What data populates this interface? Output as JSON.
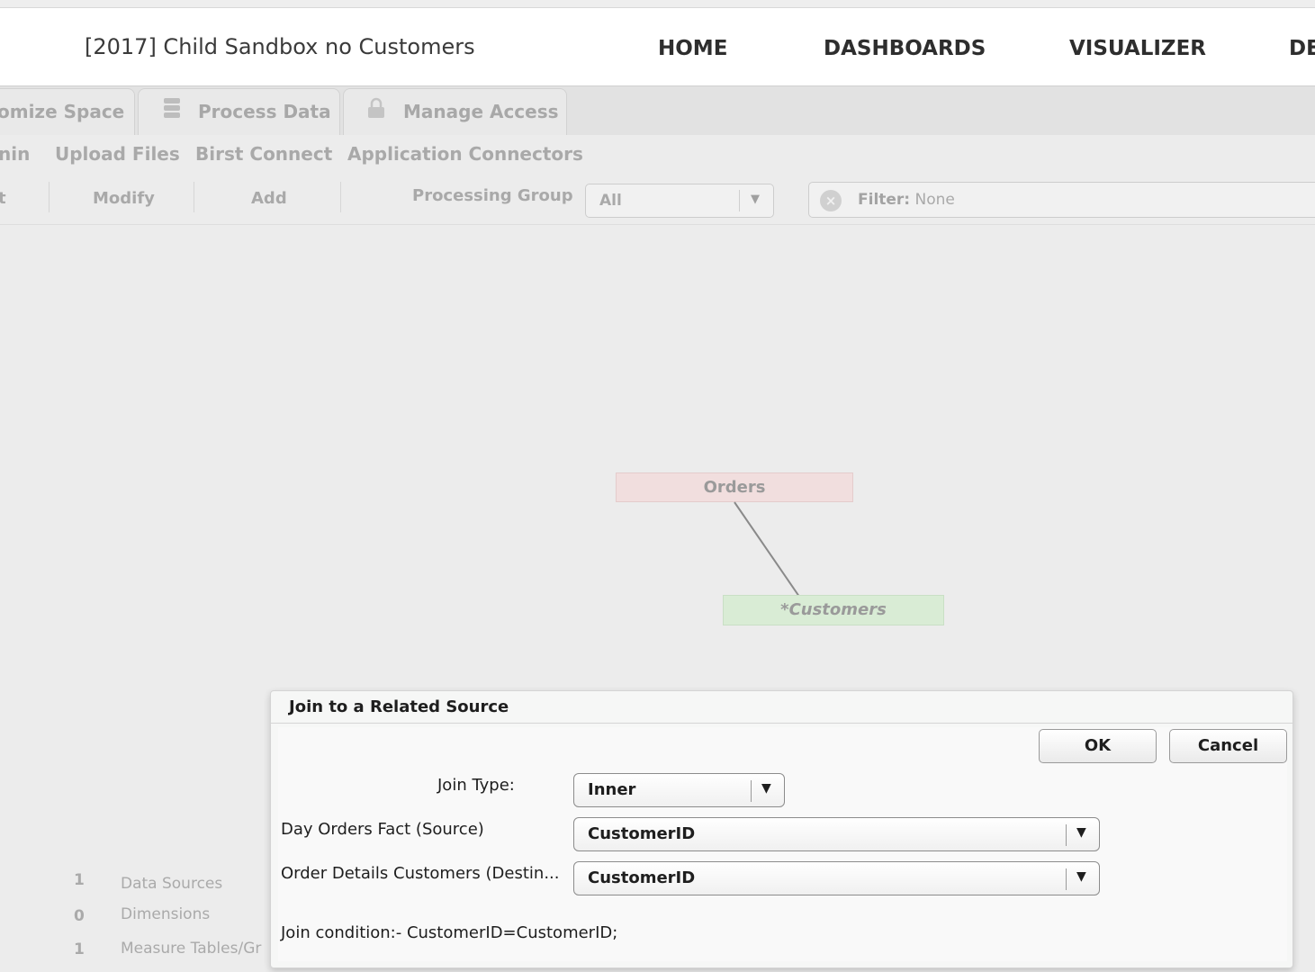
{
  "header": {
    "space_title": "[2017] Child Sandbox no Customers",
    "nav": [
      "HOME",
      "DASHBOARDS",
      "VISUALIZER",
      "DE"
    ]
  },
  "tabs": [
    {
      "label": "omize Space",
      "icon": ""
    },
    {
      "label": "Process Data",
      "icon": "database-icon"
    },
    {
      "label": "Manage Access",
      "icon": "lock-icon"
    }
  ],
  "subnav": [
    "nin",
    "Upload Files",
    "Birst Connect",
    "Application Connectors"
  ],
  "toolbar": {
    "cut_label": "t",
    "modify_label": "Modify",
    "add_label": "Add",
    "processing_group_label": "Processing Group",
    "processing_group_value": "All",
    "filter_label": "Filter:",
    "filter_value": "None"
  },
  "diagram": {
    "orders_label": "Orders",
    "customers_label": "*Customers"
  },
  "stats": [
    {
      "count": "1",
      "label": "Data Sources"
    },
    {
      "count": "0",
      "label": "Dimensions"
    },
    {
      "count": "1",
      "label": "Measure Tables/Gr"
    }
  ],
  "dialog": {
    "title": "Join to a Related Source",
    "ok_label": "OK",
    "cancel_label": "Cancel",
    "join_type_label": "Join Type:",
    "join_type_value": "Inner",
    "source_label": "Day Orders Fact (Source)",
    "source_value": "CustomerID",
    "destination_label": "Order Details Customers (Destin...",
    "destination_value": "CustomerID",
    "join_condition": "Join condition:- CustomerID=CustomerID;"
  }
}
